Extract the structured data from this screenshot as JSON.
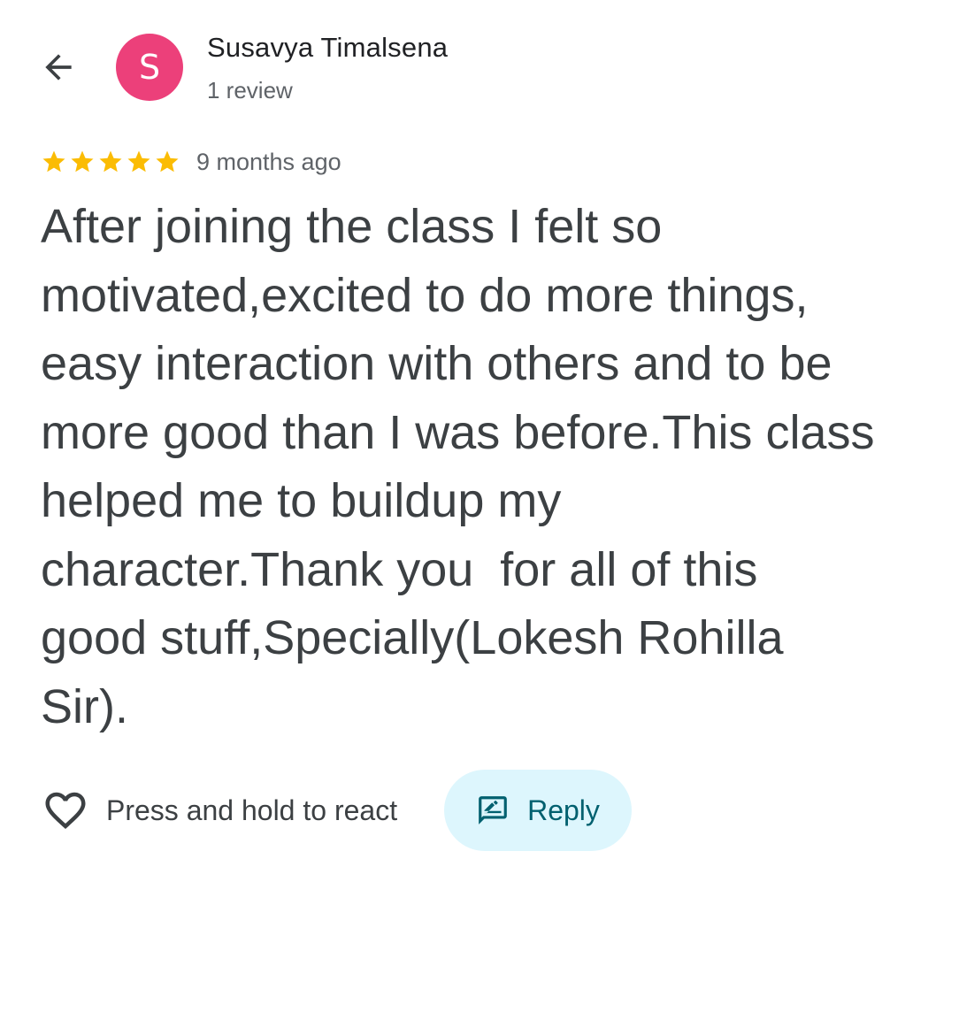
{
  "header": {
    "avatar_letter": "S",
    "avatar_color": "#ec407a",
    "reviewer_name": "Susavya Timalsena",
    "review_count": "1 review"
  },
  "review": {
    "rating": 5,
    "rating_max": 5,
    "star_color": "#fbbc04",
    "time_ago": "9 months ago",
    "text": "After joining the class I felt so\nmotivated,excited to do more things,\neasy interaction with others and to be\nmore good than I was before.This class\nhelped me to buildup my\ncharacter.Thank you  for all of this\ngood stuff,Specially(Lokesh Rohilla\nSir)."
  },
  "actions": {
    "react_label": "Press and hold to react",
    "reply_label": "Reply",
    "reply_color": "#00606f",
    "reply_bg": "#ddf6fd"
  },
  "icons": {
    "back": "arrow-back-icon",
    "heart": "heart-outline-icon",
    "reply": "reply-edit-icon",
    "star": "star-filled-icon"
  }
}
